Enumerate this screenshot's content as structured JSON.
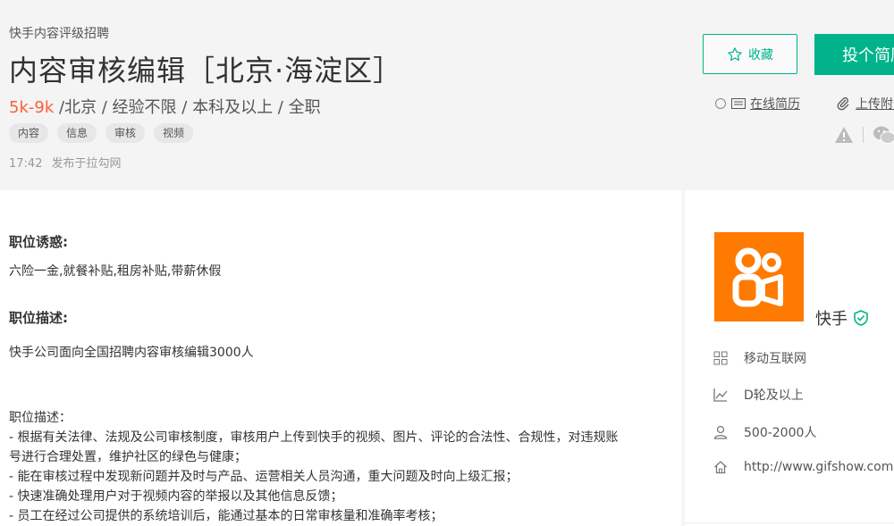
{
  "header": {
    "company_sub": "快手内容评级招聘",
    "job_title": "内容审核编辑［北京·海淀区］",
    "salary": "5k-9k",
    "requirements": "/北京 / 经验不限 / 本科及以上 / 全职",
    "tags": [
      "内容",
      "信息",
      "审核",
      "视频"
    ],
    "publish_time": "17:42",
    "publish_source": "发布于拉勾网"
  },
  "actions": {
    "favorite_label": "收藏",
    "apply_label": "投个简历",
    "online_resume_label": "在线简历",
    "upload_label": "上传附件简历"
  },
  "job_detail": {
    "advantage_title": "职位诱惑:",
    "advantage_text": "六险一金,就餐补贴,租房补贴,带薪休假",
    "desc_title": "职位描述:",
    "desc_intro": "快手公司面向全国招聘内容审核编辑3000人",
    "desc_subtitle": "职位描述：",
    "desc_items": [
      "- 根据有关法律、法规及公司审核制度，审核用户上传到快手的视频、图片、评论的合法性、合规性，对违规账",
      "号进行合理处置，维护社区的绿色与健康；",
      "- 能在审核过程中发现新问题并及时与产品、运营相关人员沟通，重大问题及时向上级汇报；",
      "- 快速准确处理用户对于视频内容的举报以及其他信息反馈；",
      "- 员工在经过公司提供的系统培训后，能通过基本的日常审核量和准确率考核；"
    ]
  },
  "company": {
    "name": "快手",
    "industry": "移动互联网",
    "stage": "D轮及以上",
    "size": "500-2000人",
    "website": "http://www.gifshow.com"
  },
  "colors": {
    "accent": "#00b38a",
    "salary": "#fd5f39",
    "logo_bg": "#ff7a00"
  }
}
